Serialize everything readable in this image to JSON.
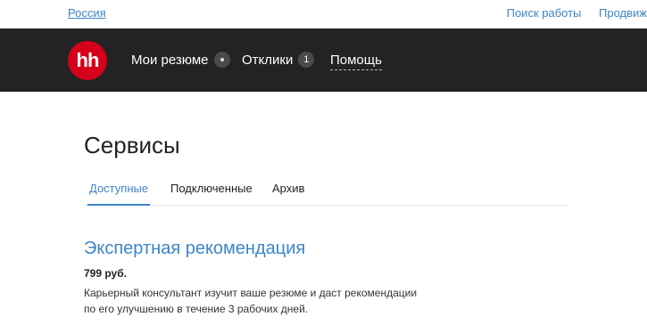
{
  "topbar": {
    "region": "Россия",
    "links": [
      "Поиск работы",
      "Продвиж"
    ]
  },
  "navbar": {
    "logo": "hh",
    "my_resume": "Мои резюме",
    "responses": "Отклики",
    "responses_count": "1",
    "help": "Помощь"
  },
  "main": {
    "title": "Сервисы",
    "tabs": [
      {
        "label": "Доступные",
        "active": true
      },
      {
        "label": "Подключенные",
        "active": false
      },
      {
        "label": "Архив",
        "active": false
      }
    ],
    "service": {
      "title": "Экспертная рекомендация",
      "price": "799 руб.",
      "description": "Карьерный консультант изучит ваше резюме и даст рекомендации по его улучшению в течение 3 рабочих дней."
    }
  },
  "colors": {
    "accent": "#3d85c6",
    "navbar_bg": "#232323",
    "logo_bg": "#d6001c"
  }
}
